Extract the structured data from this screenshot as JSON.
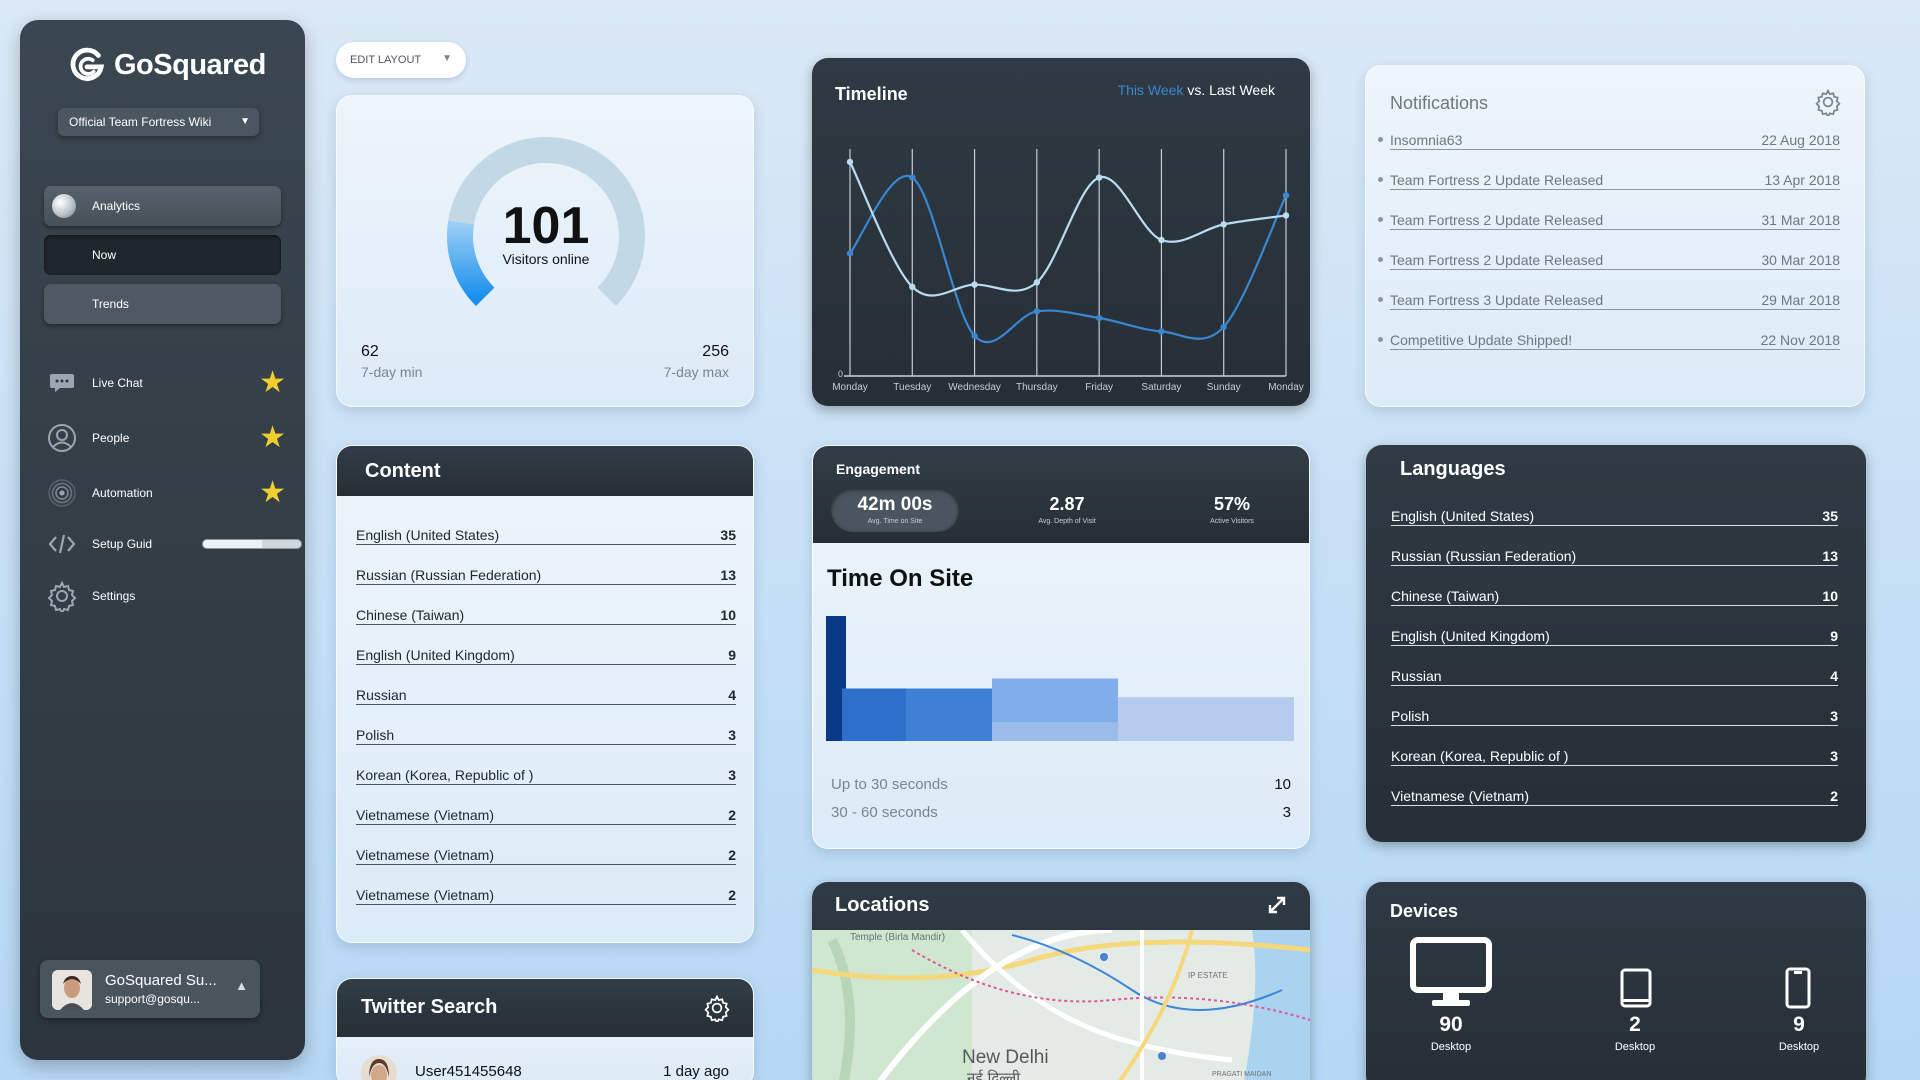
{
  "sidebar": {
    "logo_text": "GoSquared",
    "site_selector": "Official Team Fortress Wiki",
    "nav": [
      {
        "label": "Analytics"
      },
      {
        "label": "Now"
      },
      {
        "label": "Trends"
      }
    ],
    "items": [
      {
        "label": "Live Chat",
        "starred": true,
        "icon": "chat-icon"
      },
      {
        "label": "People",
        "starred": true,
        "icon": "person-icon"
      },
      {
        "label": "Automation",
        "starred": true,
        "icon": "broadcast-icon"
      },
      {
        "label": "Setup Guid",
        "icon": "code-icon",
        "progress": 0.6
      },
      {
        "label": "Settings",
        "icon": "gear-icon"
      }
    ],
    "user": {
      "name": "GoSquared Su...",
      "email": "support@gosqu..."
    }
  },
  "toolbar": {
    "edit_layout": "EDIT LAYOUT"
  },
  "visitors": {
    "value": "101",
    "label": "Visitors online",
    "min_value": "62",
    "min_label": "7-day min",
    "max_value": "256",
    "max_label": "7-day max",
    "gauge_fraction": 0.2
  },
  "timeline": {
    "title": "Timeline",
    "legend_this": "This Week",
    "legend_vs": "vs.",
    "legend_last": "Last Week",
    "zero_label": "0",
    "colors": {
      "this_week": "#3a87d0",
      "last_week": "#b9dcf2"
    }
  },
  "chart_data": {
    "type": "line",
    "categories": [
      "Monday",
      "Tuesday",
      "Wednesday",
      "Thursday",
      "Friday",
      "Saturday",
      "Sunday",
      "Monday"
    ],
    "ylim": [
      0,
      100
    ],
    "series": [
      {
        "name": "This Week",
        "values": [
          55,
          89,
          18,
          29,
          26,
          20,
          22,
          81
        ]
      },
      {
        "name": "Last Week",
        "values": [
          96,
          40,
          41,
          42,
          89,
          61,
          68,
          72
        ]
      }
    ]
  },
  "notifications": {
    "title": "Notifications",
    "items": [
      {
        "title": "Insomnia63",
        "date": "22 Aug 2018"
      },
      {
        "title": "Team Fortress 2 Update Released",
        "date": "13 Apr 2018"
      },
      {
        "title": "Team Fortress 2 Update Released",
        "date": "31 Mar 2018"
      },
      {
        "title": "Team Fortress 2 Update Released",
        "date": "30 Mar 2018"
      },
      {
        "title": "Team Fortress 3 Update Released",
        "date": "29 Mar 2018"
      },
      {
        "title": "Competitive Update Shipped!",
        "date": "22 Nov 2018"
      }
    ]
  },
  "content": {
    "title": "Content",
    "rows": [
      {
        "label": "English (United States)",
        "value": "35"
      },
      {
        "label": "Russian (Russian Federation)",
        "value": "13"
      },
      {
        "label": "Chinese (Taiwan)",
        "value": "10"
      },
      {
        "label": "English (United Kingdom)",
        "value": "9"
      },
      {
        "label": "Russian",
        "value": "4"
      },
      {
        "label": "Polish",
        "value": "3"
      },
      {
        "label": "Korean (Korea, Republic of )",
        "value": "3"
      },
      {
        "label": "Vietnamese (Vietnam)",
        "value": "2"
      },
      {
        "label": "Vietnamese (Vietnam)",
        "value": "2"
      },
      {
        "label": "Vietnamese (Vietnam)",
        "value": "2"
      }
    ]
  },
  "engagement": {
    "title": "Engagement",
    "stats": [
      {
        "value": "42m 00s",
        "label": "Avg. Time on Site"
      },
      {
        "value": "2.87",
        "label": "Avg. Depth of Visit"
      },
      {
        "value": "57%",
        "label": "Active Visitors"
      }
    ],
    "section_title": "Time On Site",
    "histogram": [
      {
        "value": 1.0,
        "color": "#0a3a86"
      },
      {
        "value": 0.42,
        "color": "#2f6fcc"
      },
      {
        "value": 0.42,
        "color": "#3f7fd6"
      },
      {
        "value": 0.5,
        "color": "#80aeea"
      },
      {
        "value": 0.15,
        "color": "#9bbcea"
      },
      {
        "value": 0.35,
        "color": "#b5ccee"
      }
    ],
    "rows": [
      {
        "label": "Up to 30 seconds",
        "value": "10"
      },
      {
        "label": "30 - 60 seconds",
        "value": "3"
      }
    ]
  },
  "languages": {
    "title": "Languages",
    "rows": [
      {
        "label": "English (United States)",
        "value": "35"
      },
      {
        "label": "Russian (Russian Federation)",
        "value": "13"
      },
      {
        "label": "Chinese (Taiwan)",
        "value": "10"
      },
      {
        "label": "English (United Kingdom)",
        "value": "9"
      },
      {
        "label": "Russian",
        "value": "4"
      },
      {
        "label": "Polish",
        "value": "3"
      },
      {
        "label": "Korean (Korea, Republic of )",
        "value": "3"
      },
      {
        "label": "Vietnamese (Vietnam)",
        "value": "2"
      }
    ]
  },
  "twitter": {
    "title": "Twitter Search",
    "user": "User451455648",
    "time": "1 day ago"
  },
  "locations": {
    "title": "Locations",
    "map_labels": {
      "city": "New Delhi",
      "city_native": "नई दिल्ली",
      "temple": "Temple (Birla Mandir)",
      "ip_estate": "IP ESTATE",
      "pragati": "PRAGATI MAIDAN"
    }
  },
  "devices": {
    "title": "Devices",
    "items": [
      {
        "value": "90",
        "label": "Desktop",
        "icon": "monitor-icon"
      },
      {
        "value": "2",
        "label": "Desktop",
        "icon": "tablet-icon"
      },
      {
        "value": "9",
        "label": "Desktop",
        "icon": "phone-icon"
      }
    ]
  }
}
